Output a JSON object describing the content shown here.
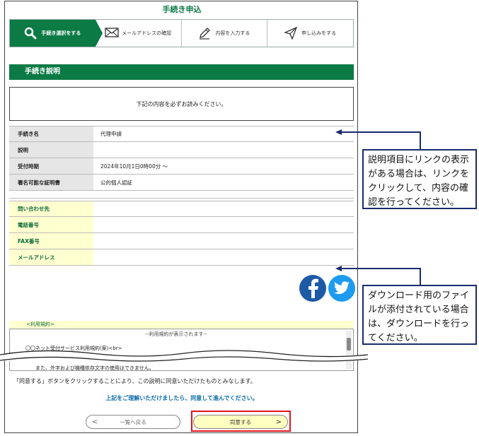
{
  "page": {
    "title": "手続き申込"
  },
  "steps": [
    {
      "label": "手続き選択をする",
      "icon": "search-icon",
      "active": true
    },
    {
      "label": "メールアドレスの確認",
      "icon": "mail-icon",
      "active": false
    },
    {
      "label": "内容を入力する",
      "icon": "pencil-icon",
      "active": false
    },
    {
      "label": "申し込みをする",
      "icon": "send-icon",
      "active": false
    }
  ],
  "section": {
    "title": "手続き説明"
  },
  "notice": "下記の内容を必ずお読みください。",
  "info": [
    {
      "label": "手続き名",
      "value": "代理申請"
    },
    {
      "label": "説明",
      "value": ""
    },
    {
      "label": "受付時期",
      "value": "2024年10月1日0時00分 ～"
    },
    {
      "label": "署名可能な証明書",
      "value": "公的個人認証"
    }
  ],
  "contact": [
    {
      "label": "問い合わせ先",
      "value": ""
    },
    {
      "label": "電話番号",
      "value": ""
    },
    {
      "label": "FAX番号",
      "value": ""
    },
    {
      "label": "メールアドレス",
      "value": ""
    }
  ],
  "terms": {
    "label": "<利用規約>",
    "line1": "--利用規約が表示されます--",
    "line2": "〇〇ネット受付サービス利用規約(案)<br>",
    "line3": "また、外字および機種依存文字の使用はできません。"
  },
  "agree_text": "「同意する」ボタンをクリックすることにより、この説明に同意いただけたものとみなします。",
  "confirm_text": "上記をご理解いただけましたら、同意して進んでください。",
  "buttons": {
    "back": {
      "label": "一覧へ戻る",
      "arrow": "<"
    },
    "agree": {
      "label": "同意する",
      "arrow": ">"
    }
  },
  "callouts": {
    "link": "説明項目にリンクの表示がある場合は、リンクをクリックして、内容の確認を行ってください。",
    "download": "ダウンロード用のファイルが添付されている場合は、ダウンロードを行ってください。"
  },
  "colors": {
    "brand": "#0b7a45",
    "highlight": "#e0141e",
    "callout_border": "#1a2b6d"
  }
}
